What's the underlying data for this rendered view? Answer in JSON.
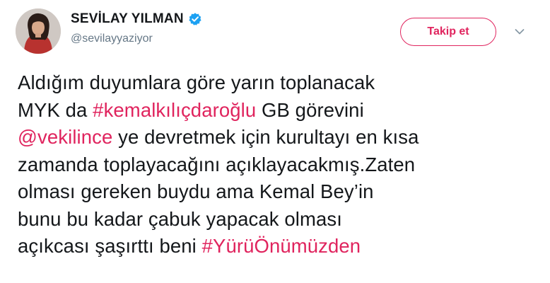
{
  "user": {
    "display_name": "SEVİLAY YILMAN",
    "handle": "@sevilayyaziyor",
    "verified": true
  },
  "actions": {
    "follow_label": "Takip et",
    "menu_icon": "chevron-down-icon"
  },
  "tweet": {
    "line1": "Aldığım duyumlara göre yarın toplanacak",
    "line2_pre": "MYK da ",
    "line2_hashtag": "#kemalkılıçdaroğlu",
    "line2_post": " GB görevini",
    "line3_mention": "@vekilince",
    "line3_post": " ye devretmek için kurultayı en kısa",
    "line4": "zamanda toplayacağını açıklayacakmış.Zaten",
    "line5": "olması gereken buydu ama Kemal Bey’in",
    "line6": "bunu bu kadar çabuk yapacak olması",
    "line7_pre": "açıkcası şaşırttı beni ",
    "line7_hashtag": "#YürüÖnümüzden"
  },
  "colors": {
    "accent": "#e0245e",
    "verified_badge": "#1da1f2",
    "text": "#14171a",
    "muted": "#657786"
  }
}
